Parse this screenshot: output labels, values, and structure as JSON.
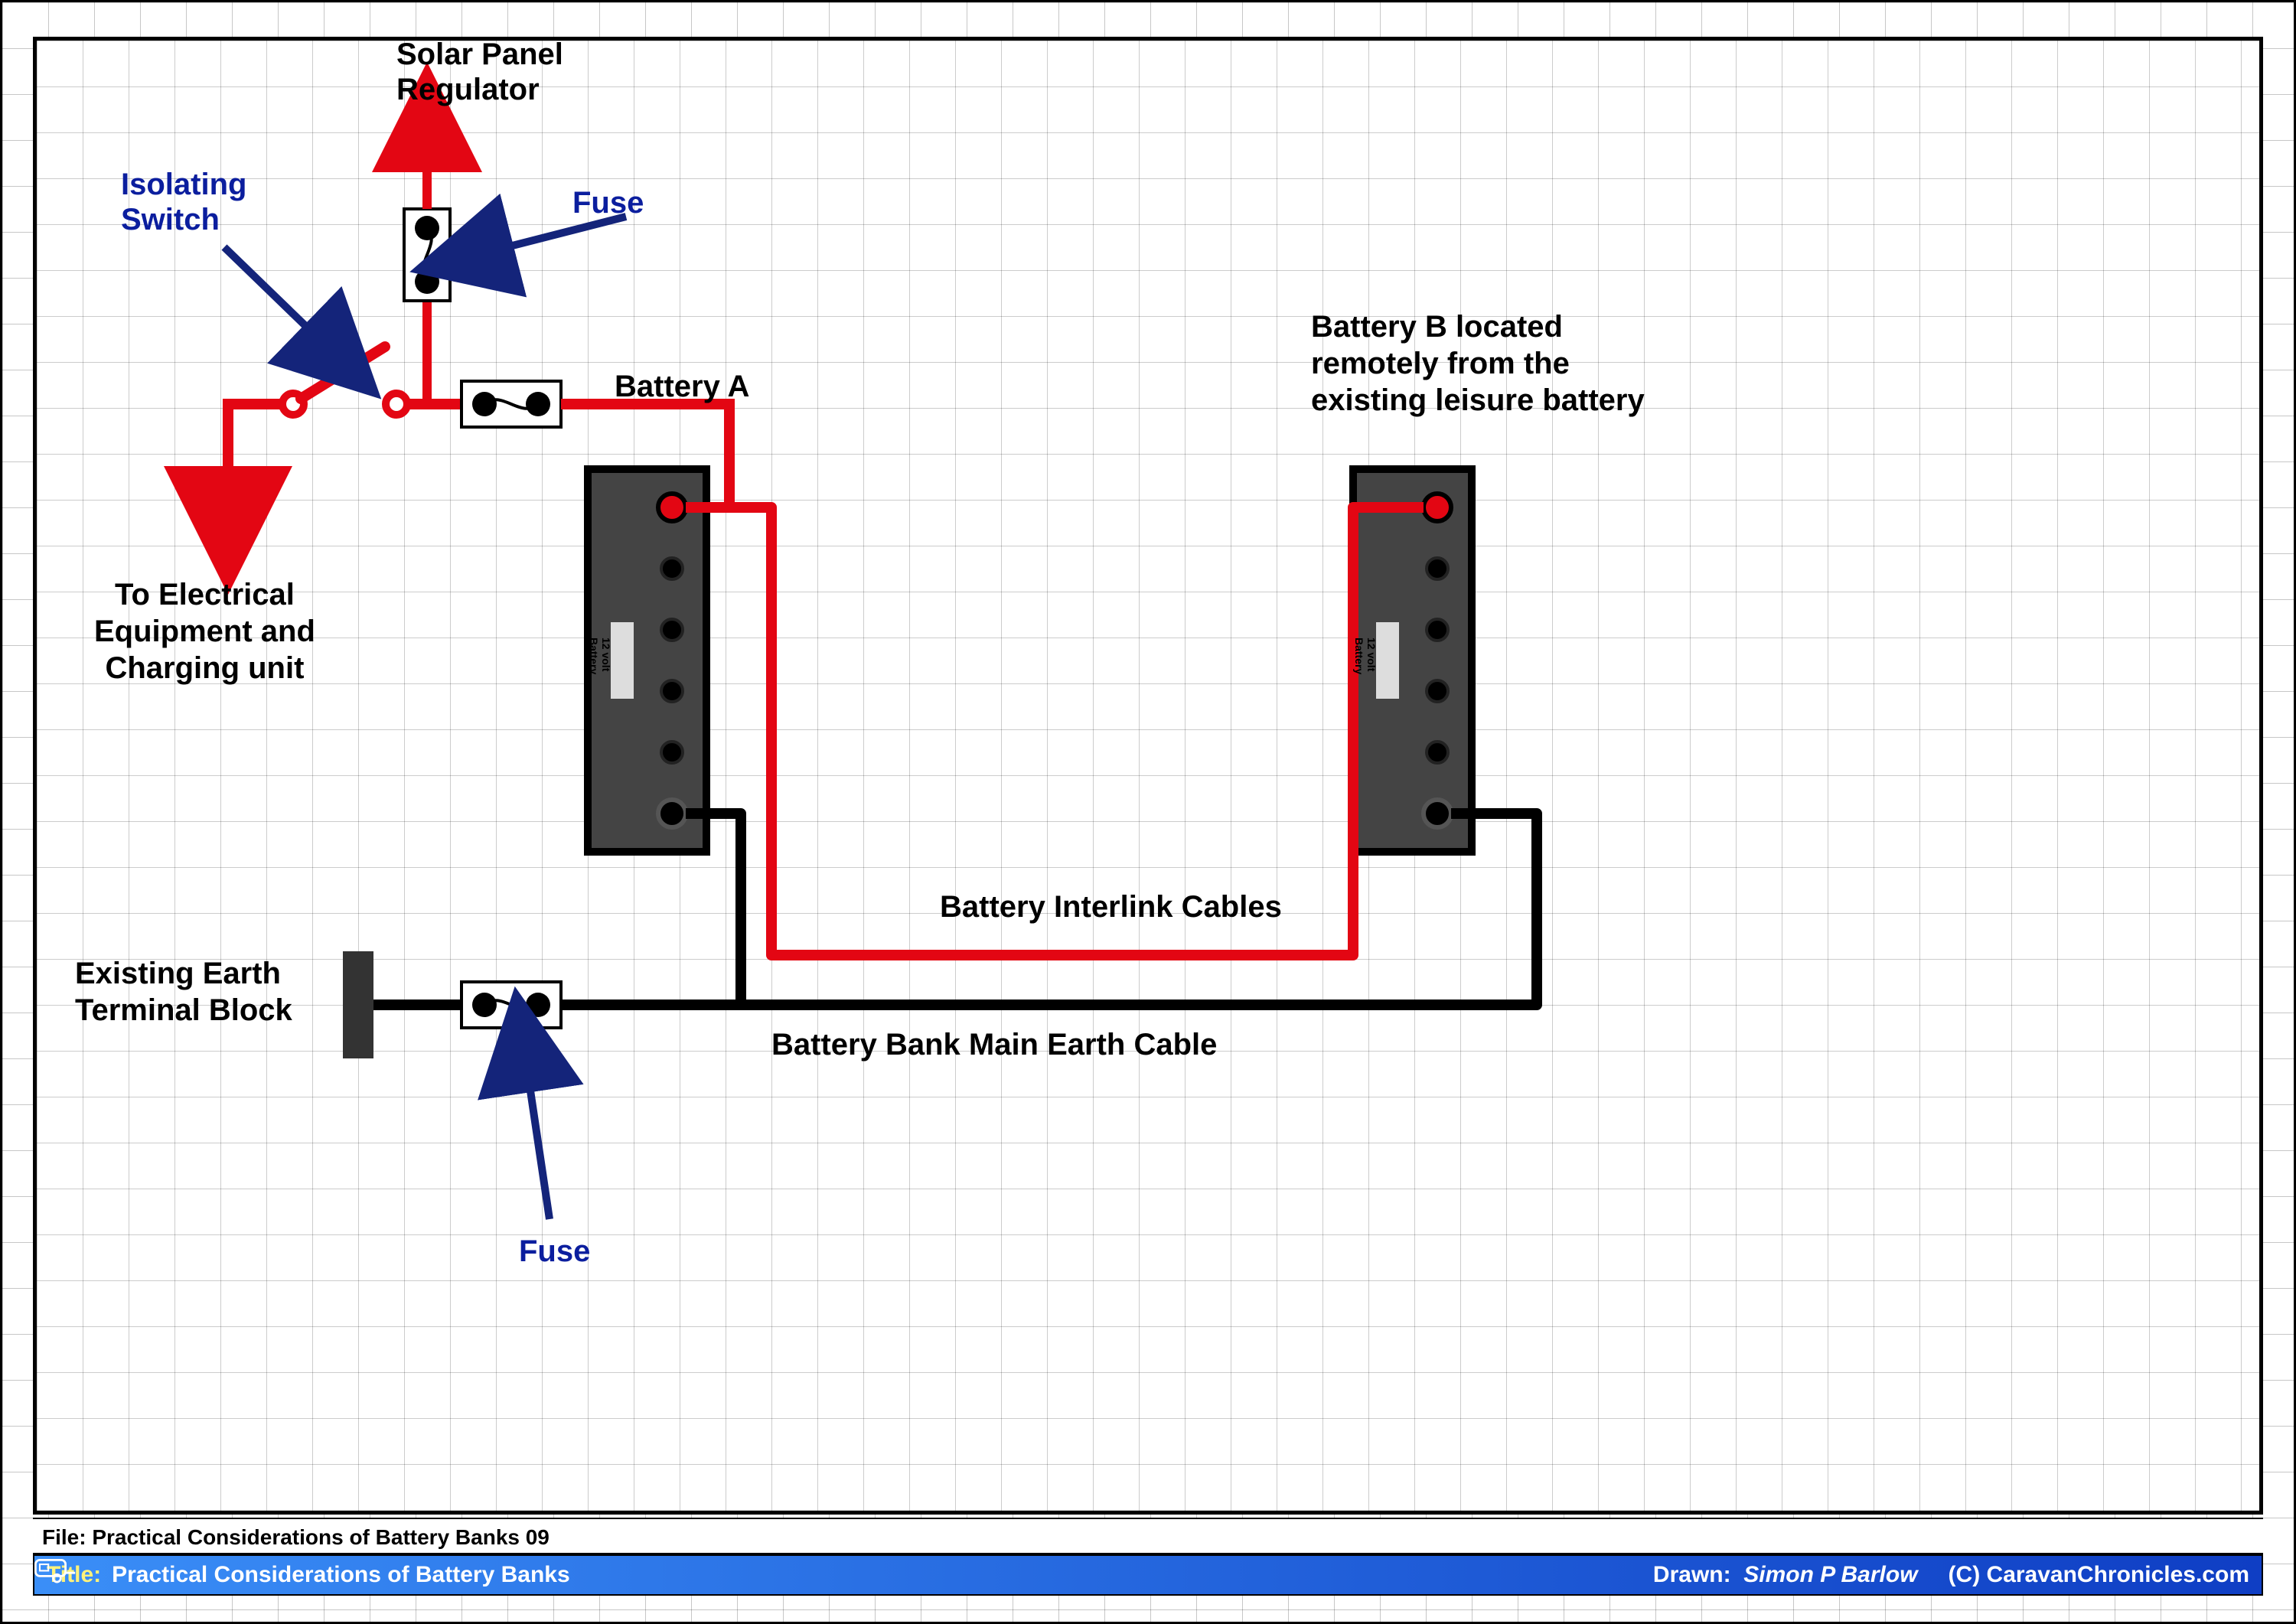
{
  "labels": {
    "solar_panel_regulator": "Solar Panel\nRegulator",
    "isolating_switch": "Isolating\nSwitch",
    "fuse_top": "Fuse",
    "fuse_bottom": "Fuse",
    "battery_a": "Battery A",
    "battery_b": "Battery B located\nremotely from the\nexisting leisure battery",
    "to_electrical": "To Electrical\nEquipment and\nCharging unit",
    "existing_earth": "Existing Earth\nTerminal Block",
    "interlink": "Battery Interlink Cables",
    "main_earth": "Battery Bank Main Earth Cable",
    "battery_marker": "12 volt\nBattery"
  },
  "file_line": "File: Practical Considerations of Battery Banks 09",
  "title_bar": {
    "title_label": "Title:",
    "title_value": "Practical Considerations of Battery Banks",
    "drawn_label": "Drawn:",
    "drawn_value": "Simon P Barlow",
    "site": "(C) CaravanChronicles.com"
  },
  "colors": {
    "red": "#e30613",
    "black": "#000000",
    "blue_label": "#0b1e9e",
    "navy_arrow": "#14247a",
    "title_yellow": "#fff27a",
    "title_grad_left": "#3a8ef7",
    "title_grad_right": "#0f3ec4",
    "battery_body": "#444444"
  },
  "components": {
    "isolating_switch": {
      "type": "switch",
      "state": "open"
    },
    "fuse_top_vertical": {
      "type": "fuse",
      "orientation": "vertical"
    },
    "fuse_inline_red": {
      "type": "fuse",
      "orientation": "horizontal"
    },
    "fuse_inline_earth": {
      "type": "fuse",
      "orientation": "horizontal"
    },
    "battery_a": {
      "type": "battery",
      "voltage": "12 volt",
      "terminals": 6
    },
    "battery_b": {
      "type": "battery",
      "voltage": "12 volt",
      "terminals": 6
    },
    "earth_terminal_block": {
      "type": "terminal-block"
    }
  }
}
